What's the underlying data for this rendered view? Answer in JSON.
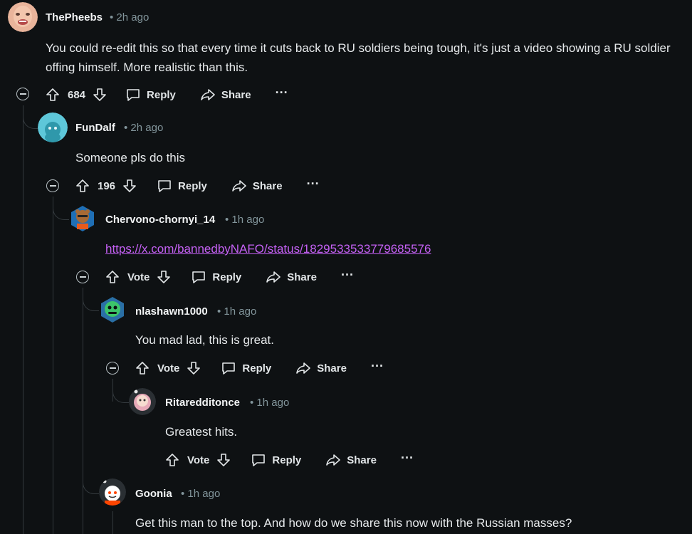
{
  "comments": [
    {
      "author": "ThePheebs",
      "age": "• 2h ago",
      "text": "You could re-edit this so that every time it cuts back to RU soldiers being tough, it's just a video showing a RU soldier offing himself. More realistic than this.",
      "score": "684",
      "reply": "Reply",
      "share": "Share"
    },
    {
      "author": "FunDalf",
      "age": "• 2h ago",
      "text": "Someone pls do this",
      "score": "196",
      "reply": "Reply",
      "share": "Share"
    },
    {
      "author": "Chervono-chornyi_14",
      "age": "• 1h ago",
      "link": "https://x.com/bannedbyNAFO/status/1829533533779685576",
      "score": "Vote",
      "reply": "Reply",
      "share": "Share"
    },
    {
      "author": "nlashawn1000",
      "age": "• 1h ago",
      "text": "You mad lad, this is great.",
      "score": "Vote",
      "reply": "Reply",
      "share": "Share"
    },
    {
      "author": "Ritaredditonce",
      "age": "• 1h ago",
      "text": "Greatest hits.",
      "score": "Vote",
      "reply": "Reply",
      "share": "Share"
    },
    {
      "author": "Goonia",
      "age": "• 1h ago",
      "text": "Get this man to the top. And how do we share this now with the Russian masses?"
    }
  ],
  "more": "···",
  "icons": {
    "upvote": "upvote-icon",
    "downvote": "downvote-icon",
    "reply": "reply-bubble-icon",
    "share": "share-arrow-icon",
    "collapse": "collapse-minus-icon"
  }
}
